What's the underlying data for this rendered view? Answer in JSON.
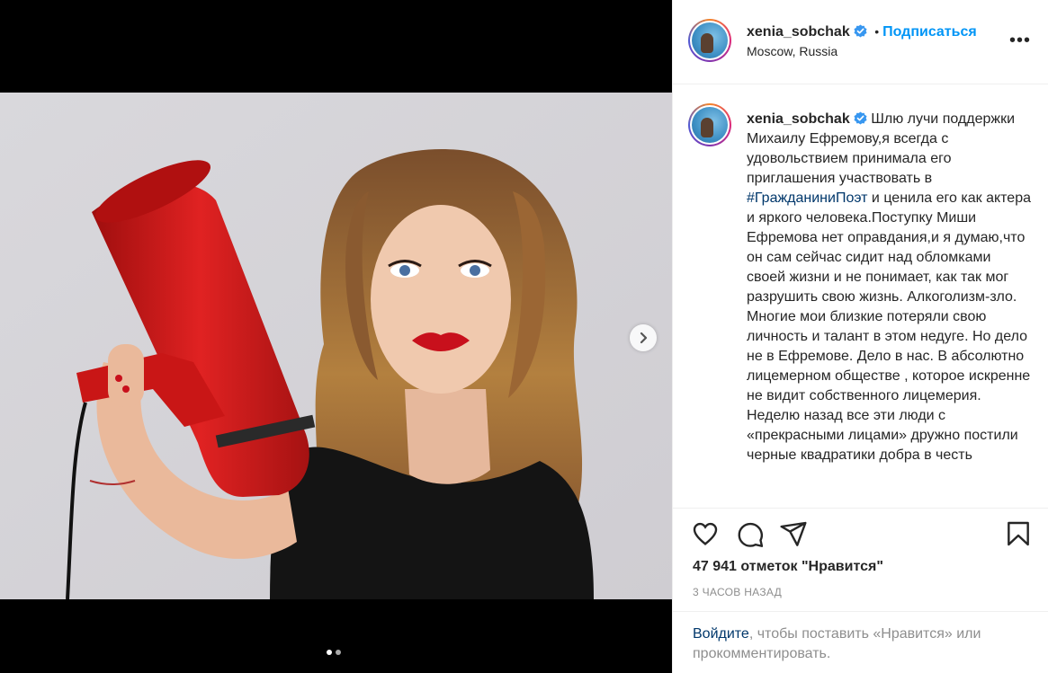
{
  "post": {
    "username": "xenia_sobchak",
    "follow_label": "Подписаться",
    "separator": "•",
    "location": "Moscow, Russia",
    "more_label": "•••",
    "caption_part1": "Шлю лучи поддержки Михаилу Ефремову,я всегда с удовольствием принимала его приглашения участвовать в ",
    "hashtag": "#ГражданиниПоэт",
    "caption_part2": " и ценила его как актера и яркого человека.Поступку Миши Ефремова нет оправдания,и я думаю,что он сам сейчас сидит над обломками своей жизни и не понимает, как так мог разрушить свою жизнь. Алкоголизм-зло. Многие мои близкие потеряли свою личность и талант в этом недуге. Но дело не в Ефремове. Дело в нас. В абсолютно лицемерном обществе , которое искренне не видит собственного лицемерия. Неделю назад все эти люди с «прекрасными лицами» дружно постили черные квадратики добра в честь",
    "likes": "47 941 отметок \"Нравится\"",
    "time": "3 ЧАСОВ НАЗАД",
    "login_link": "Войдите",
    "login_rest": ", чтобы поставить «Нравится» или прокомментировать."
  },
  "carousel": {
    "current": 1,
    "total": 2
  },
  "icons": {
    "like": "heart-icon",
    "comment": "comment-icon",
    "share": "paper-plane-icon",
    "save": "bookmark-icon",
    "next": "chevron-right-icon",
    "verified": "verified-badge-icon"
  },
  "colors": {
    "accent": "#0095f6",
    "hashtag": "#00376b",
    "muted": "#8e8e8e",
    "verified": "#3897f0",
    "megaphone": "#d11a1a"
  }
}
